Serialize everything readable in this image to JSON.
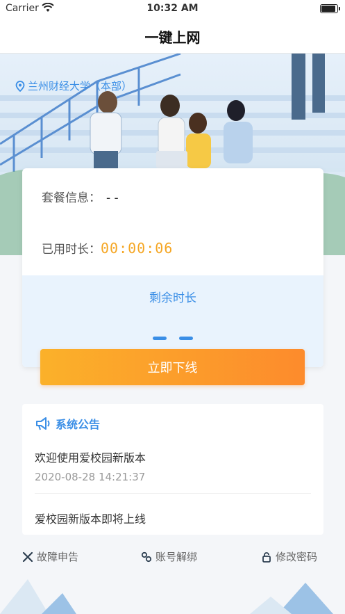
{
  "status_bar": {
    "carrier": "Carrier",
    "time": "10:32 AM"
  },
  "nav": {
    "title": "一键上网"
  },
  "banner": {
    "location": "兰州财经大学（本部）"
  },
  "card": {
    "package_label": "套餐信息：",
    "package_value": "- -",
    "used_label": "已用时长：",
    "used_value": "00:00:06",
    "remaining_label": "剩余时长"
  },
  "actions": {
    "offline_label": "立即下线"
  },
  "notice": {
    "title": "系统公告",
    "items": [
      {
        "title": "欢迎使用爱校园新版本",
        "date": "2020-08-28 14:21:37"
      },
      {
        "title": "爱校园新版本即将上线"
      }
    ]
  },
  "links": [
    {
      "label": "故障申告",
      "icon": "tools-icon"
    },
    {
      "label": "账号解绑",
      "icon": "unlink-icon"
    },
    {
      "label": "修改密码",
      "icon": "lock-icon"
    }
  ],
  "colors": {
    "accent": "#3a8ee6",
    "timer": "#f5a623",
    "button_start": "#fbb12a",
    "button_end": "#fd8b2c"
  }
}
